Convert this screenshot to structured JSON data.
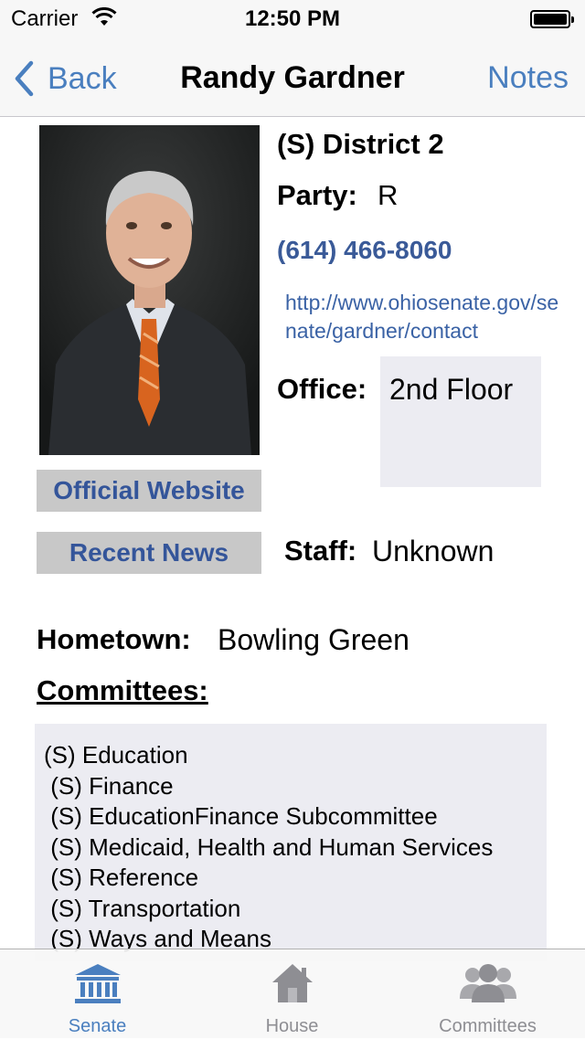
{
  "status_bar": {
    "carrier": "Carrier",
    "time": "12:50 PM"
  },
  "nav": {
    "back_label": "Back",
    "title": "Randy Gardner",
    "right_label": "Notes"
  },
  "profile": {
    "district": "(S) District 2",
    "party_label": "Party:",
    "party_value": "R",
    "phone": "(614) 466-8060",
    "contact_url": "http://www.ohiosenate.gov/senate/gardner/contact",
    "office_label": "Office:",
    "office_value": "2nd Floor",
    "staff_label": "Staff:",
    "staff_value": "Unknown",
    "hometown_label": "Hometown:",
    "hometown_value": "Bowling Green",
    "committees_label": "Committees:",
    "committees_text": "(S) Education\n (S) Finance\n (S) EducationFinance Subcommittee\n (S) Medicaid, Health and Human Services\n (S) Reference\n (S) Transportation\n (S) Ways and Means"
  },
  "buttons": {
    "official_website": "Official Website",
    "recent_news": "Recent News"
  },
  "tabs": [
    {
      "label": "Senate",
      "icon": "senate-building-icon",
      "active": true
    },
    {
      "label": "House",
      "icon": "house-icon",
      "active": false
    },
    {
      "label": "Committees",
      "icon": "people-group-icon",
      "active": false
    }
  ],
  "colors": {
    "accent": "#4a7fbf",
    "link": "#3a5a98",
    "button_bg": "#c8c8c8",
    "box_bg": "#ececf2"
  }
}
